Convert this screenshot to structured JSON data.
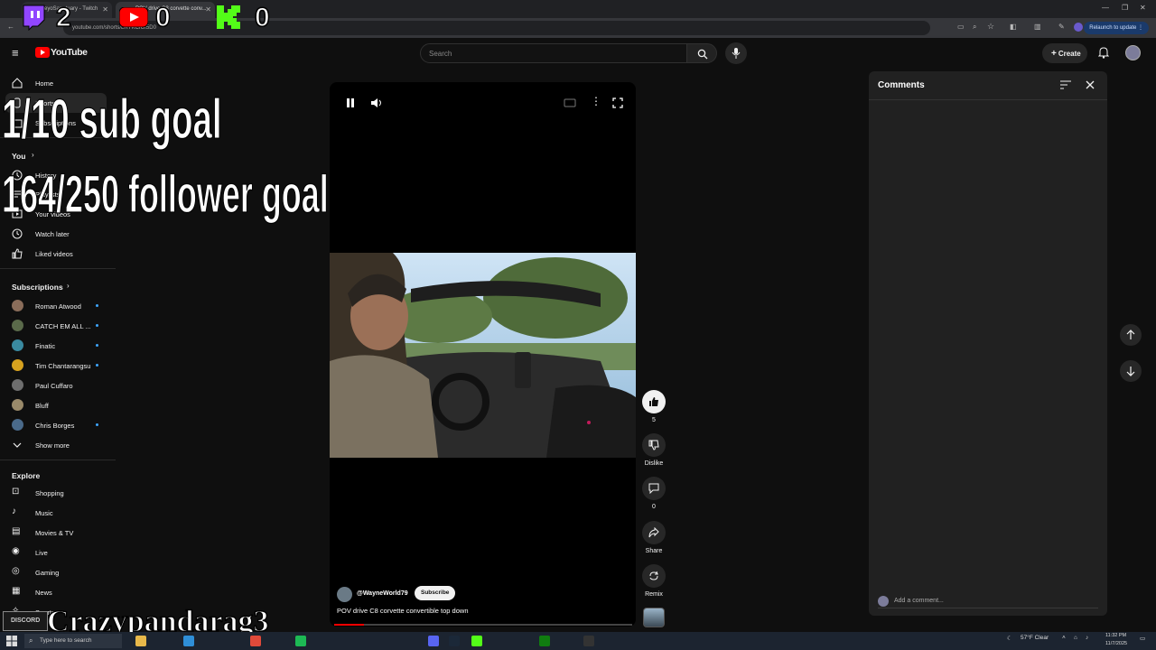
{
  "browser": {
    "tabs": [
      {
        "label": "veyoSan_tuary - Twitch"
      },
      {
        "label": "POV drive C8 corvette conv..."
      }
    ],
    "url": "youtube.com/shorts/LRYKCIGf5D0",
    "relaunch_label": "Relaunch to update"
  },
  "overlay": {
    "twitch_subs": "2",
    "youtube_subs": "0",
    "kick_followers": "0",
    "sub_goal": "1/10 sub goal",
    "follower_goal": "164/250 follower goal",
    "streamer_name": "Crazypandarag3",
    "discord_label": "DISCORD"
  },
  "header": {
    "logo_text": "YouTube",
    "search_placeholder": "Search",
    "create_label": "Create"
  },
  "sidebar": {
    "home": "Home",
    "shorts": "Shorts",
    "subscriptions_link": "Subscriptions",
    "you_label": "You",
    "history": "History",
    "playlists": "Playlists",
    "your_videos": "Your videos",
    "watch_later": "Watch later",
    "liked_videos": "Liked videos",
    "subscriptions_header": "Subscriptions",
    "subscriptions": [
      {
        "name": "Roman Atwood",
        "color": "#8a6d5a"
      },
      {
        "name": "CATCH EM ALL ...",
        "color": "#5a6a4a"
      },
      {
        "name": "Finatic",
        "color": "#3a8aa0"
      },
      {
        "name": "Tim Chantarangsu",
        "color": "#d7a21f"
      },
      {
        "name": "Paul Cuffaro",
        "color": "#6e6e6e"
      },
      {
        "name": "Bluff",
        "color": "#9a8a6a"
      },
      {
        "name": "Chris Borges",
        "color": "#4a6a8a"
      }
    ],
    "show_more": "Show more",
    "explore_header": "Explore",
    "explore": [
      "Shopping",
      "Music",
      "Movies & TV",
      "Live",
      "Gaming",
      "News",
      "Sports"
    ]
  },
  "short": {
    "channel": "@WayneWorld79",
    "subscribe_label": "Subscribe",
    "title": "POV drive C8 corvette convertible top down",
    "progress": 0.1
  },
  "actions": {
    "like_count": "5",
    "dislike_label": "Dislike",
    "comment_count": "0",
    "share_label": "Share",
    "remix_label": "Remix"
  },
  "comments": {
    "title": "Comments",
    "input_placeholder": "Add a comment..."
  },
  "taskbar": {
    "search_placeholder": "Type here to search",
    "weather": "57°F Clear",
    "time": "11:32 PM",
    "date": "11/7/2025"
  },
  "colors": {
    "youtube_red": "#ff0000",
    "twitch_purple": "#9146ff",
    "kick_green": "#53fc18",
    "link_blue": "#3ea6ff"
  }
}
